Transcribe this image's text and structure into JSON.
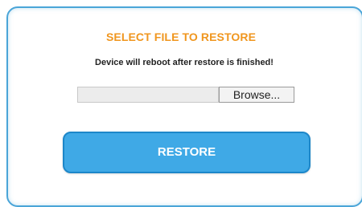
{
  "restore_panel": {
    "title": "SELECT FILE TO RESTORE",
    "notice": "Device will reboot after restore is finished!",
    "file_input": {
      "value": "",
      "browse_label": "Browse..."
    },
    "restore_label": "RESTORE"
  },
  "colors": {
    "title": "#f0961e",
    "panel_border": "#4aa5d8",
    "restore_button": "#3fa9e6",
    "restore_button_border": "#1d87c9"
  }
}
